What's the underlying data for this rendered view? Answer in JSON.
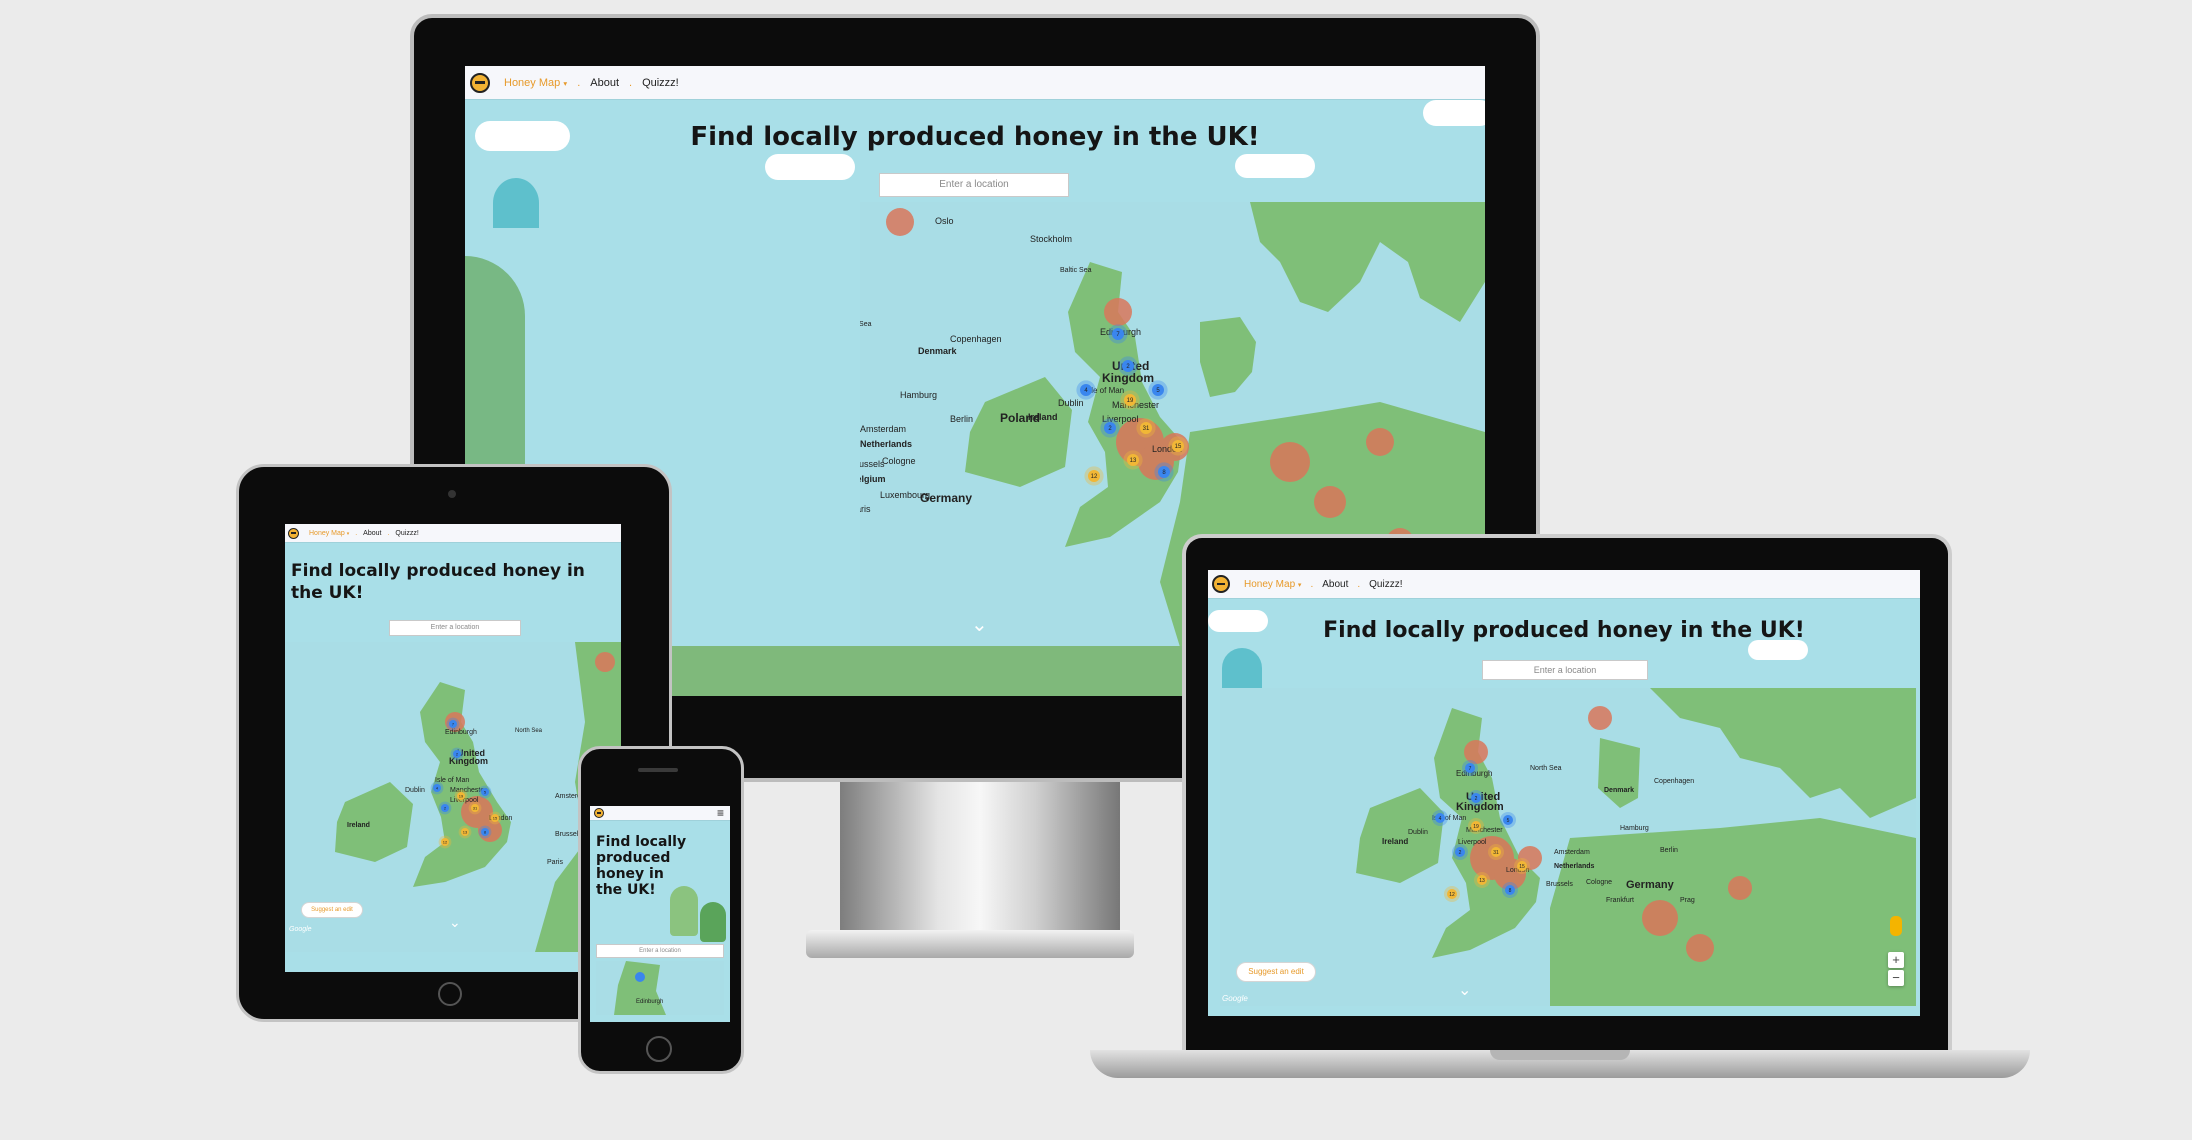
{
  "site": {
    "nav": {
      "honey_map": "Honey Map",
      "caret": "▾",
      "about": "About",
      "quiz": "Quizzz!",
      "separator": "."
    },
    "headline": "Find locally produced honey in the UK!",
    "search_placeholder": "Enter a location",
    "suggest_edit": "Suggest an edit",
    "google": "Google",
    "zoom_in": "+",
    "zoom_out": "−",
    "chevron": "⌄",
    "menu_icon": "≡"
  },
  "map": {
    "labels": {
      "oslo": "Oslo",
      "stockholm": "Stockholm",
      "baltic": "Baltic Sea",
      "north_sea": "North Sea",
      "edinburgh": "Edinburgh",
      "uk1": "United",
      "uk2": "Kingdom",
      "denmark": "Denmark",
      "copenhagen": "Copenhagen",
      "isle": "Isle of Man",
      "manchester": "Manchester",
      "dublin": "Dublin",
      "ireland": "Ireland",
      "liverpool": "Liverpool",
      "hamburg": "Hamburg",
      "amsterdam": "Amsterdam",
      "netherlands": "Netherlands",
      "berlin": "Berlin",
      "poland": "Poland",
      "london": "London",
      "brussels": "Brussels",
      "belgium": "Belgium",
      "cologne": "Cologne",
      "germany": "Germany",
      "frankfurt": "Frankfurt",
      "luxembourg": "Luxembourg",
      "paris": "Paris",
      "prague": "Prag"
    },
    "clusters": [
      {
        "label": "7",
        "color": "#3a86ee"
      },
      {
        "label": "2",
        "color": "#3a86ee"
      },
      {
        "label": "4",
        "color": "#3a86ee"
      },
      {
        "label": "5",
        "color": "#3a86ee"
      },
      {
        "label": "19",
        "color": "#f1b736"
      },
      {
        "label": "2",
        "color": "#3a86ee"
      },
      {
        "label": "31",
        "color": "#f1b736"
      },
      {
        "label": "13",
        "color": "#f1b736"
      },
      {
        "label": "12",
        "color": "#f1b736"
      },
      {
        "label": "15",
        "color": "#f1b736"
      },
      {
        "label": "8",
        "color": "#3a86ee"
      }
    ]
  },
  "colors": {
    "accent": "#e79a2a",
    "sea": "#a9dde6",
    "land": "#7fbf78",
    "urban": "#d9775a"
  }
}
